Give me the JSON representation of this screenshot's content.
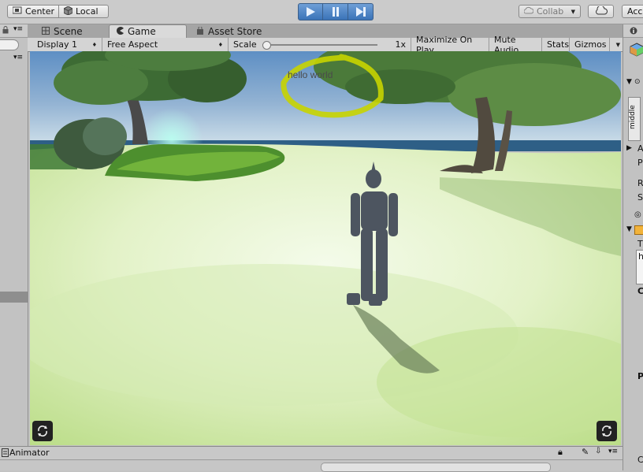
{
  "toolbar": {
    "pivot_label": "Center",
    "space_label": "Local",
    "collab_label": "Collab",
    "account_label": "Acco"
  },
  "tabs": [
    {
      "label": "Scene"
    },
    {
      "label": "Game"
    },
    {
      "label": "Asset Store"
    }
  ],
  "game_toolbar": {
    "display": "Display 1",
    "aspect": "Free Aspect",
    "scale_label": "Scale",
    "scale_value": "1x",
    "scale_fraction": 0.0,
    "maximize": "Maximize On Play",
    "mute": "Mute Audio",
    "stats": "Stats",
    "gizmos": "Gizmos"
  },
  "game": {
    "annotation_text": "hello world",
    "annotation_color": "#c8d400"
  },
  "inspector": {
    "text_middle": "middle",
    "letters": [
      "A",
      "P",
      "R",
      "S",
      "T",
      "h",
      "C",
      "P",
      "C"
    ]
  },
  "bottom": {
    "animator_label": "Animator"
  },
  "colors": {
    "play_active": "#3a73b8",
    "sky": "#7fa6cc",
    "ground": "#cfe89b"
  }
}
